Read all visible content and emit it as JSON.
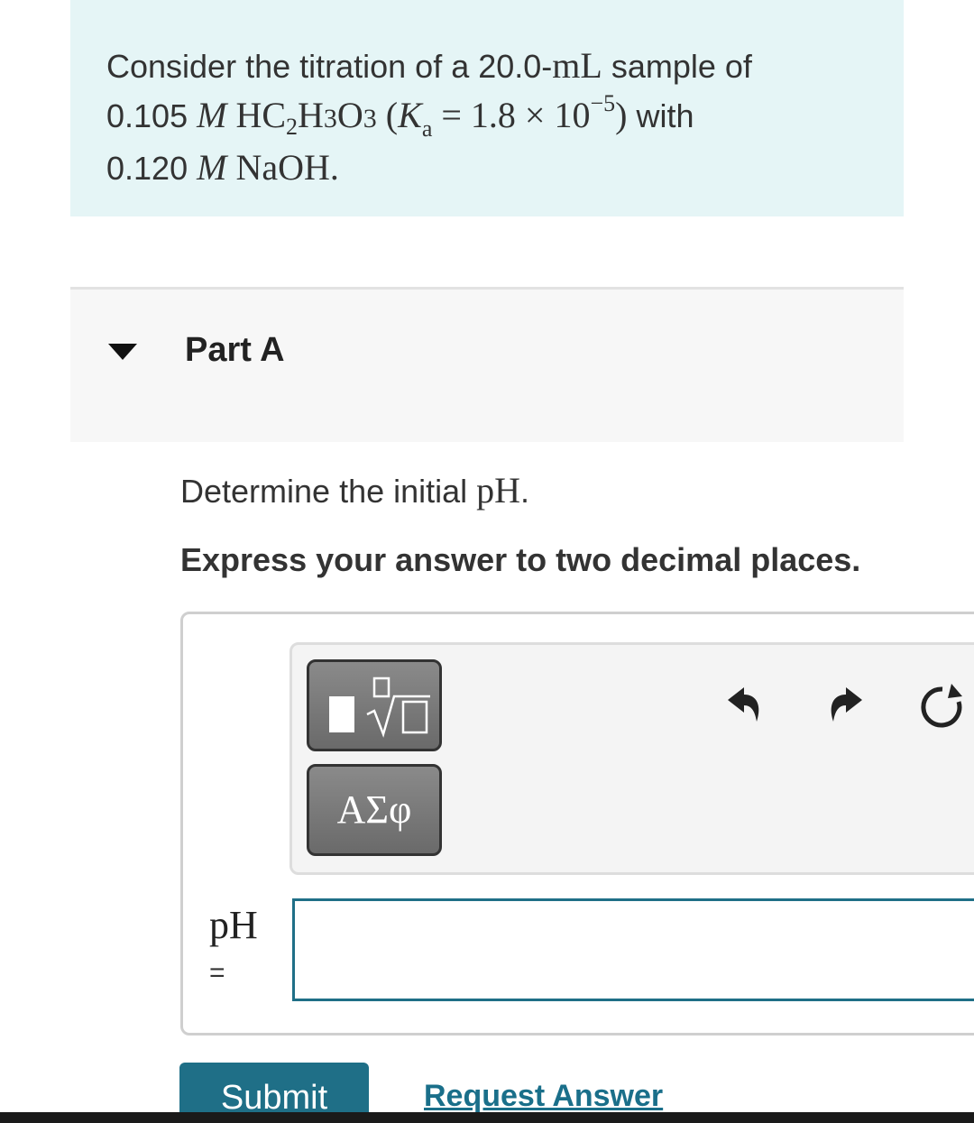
{
  "problem": {
    "line1_prefix": "Consider the titration of a 20.0-",
    "line1_unit": "mL",
    "line1_suffix": " sample of",
    "line2_conc": "0.105",
    "molar_symbol": "M",
    "acid_formula_parts": [
      "HC",
      "2",
      "H",
      "3",
      "O",
      "3"
    ],
    "ka_symbol": "K",
    "ka_sub": "a",
    "ka_value": "= 1.8 × 10",
    "ka_exponent": "−5",
    "line2_suffix": " with",
    "line3_conc": "0.120",
    "base_formula": "NaOH."
  },
  "part": {
    "title": "Part A"
  },
  "question": {
    "prefix": "Determine the initial ",
    "quantity": "pH",
    "suffix": ".",
    "instruction": "Express your answer to two decimal places."
  },
  "answer": {
    "label": "pH",
    "equals": "=",
    "value": "",
    "placeholder": ""
  },
  "toolbar": {
    "greek_label": "ΑΣφ",
    "templates_icon": "templates-sqrt-icon",
    "undo_icon": "undo-icon",
    "redo_icon": "redo-icon",
    "reset_icon": "reset-icon"
  },
  "actions": {
    "submit_label": "Submit",
    "request_answer_label": "Request Answer"
  },
  "colors": {
    "problem_bg": "#e5f5f6",
    "primary": "#1f6f87"
  }
}
